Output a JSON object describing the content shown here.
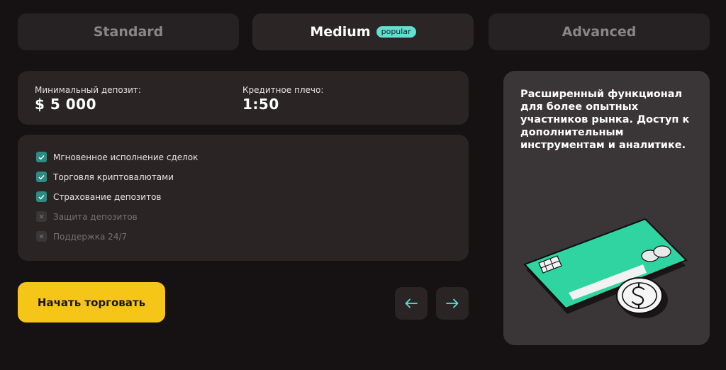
{
  "tabs": [
    {
      "label": "Standard",
      "active": false
    },
    {
      "label": "Medium",
      "active": true,
      "badge": "popular"
    },
    {
      "label": "Advanced",
      "active": false
    }
  ],
  "info": {
    "min_deposit_label": "Минимальный депозит:",
    "min_deposit_value": "$ 5 000",
    "leverage_label": "Кредитное плечо:",
    "leverage_value": "1:50"
  },
  "features": [
    {
      "label": "Мгновенное исполнение сделок",
      "enabled": true
    },
    {
      "label": "Торговля криптовалютами",
      "enabled": true
    },
    {
      "label": "Страхование депозитов",
      "enabled": true
    },
    {
      "label": "Защита депозитов",
      "enabled": false
    },
    {
      "label": "Поддержка 24/7",
      "enabled": false
    }
  ],
  "cta": {
    "label": "Начать торговать"
  },
  "description": "Расширенный функционал для более опытных участников рынка. Доступ к дополнительным инструментам и аналитике.",
  "icons": {
    "prev": "arrow-left-icon",
    "next": "arrow-right-icon",
    "illustration": "credit-card-coin-icon"
  },
  "colors": {
    "accent": "#f5c518",
    "teal": "#5fe0d1",
    "check": "#2c8c84",
    "card_green": "#2fd4a0"
  }
}
